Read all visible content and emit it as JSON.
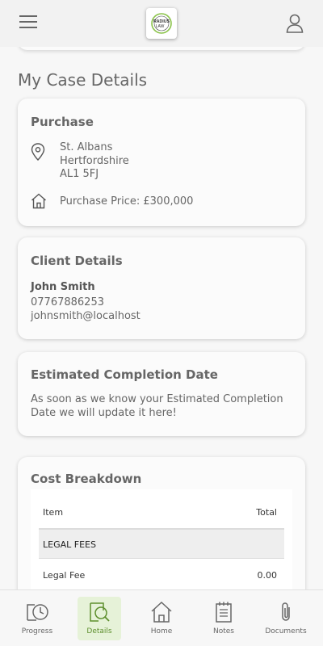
{
  "header": {
    "logo_text_line1": "RADIUS",
    "logo_text_line2": "LAW"
  },
  "page_title": "My Case Details",
  "purchase": {
    "title": "Purchase",
    "address_line1": "St. Albans",
    "address_line2": "Hertfordshire",
    "address_line3": "AL1 5FJ",
    "price_text": "Purchase Price: £300,000"
  },
  "client": {
    "title": "Client Details",
    "name": "John Smith",
    "phone": "07767886253",
    "email": "johnsmith@localhost"
  },
  "completion": {
    "title": "Estimated Completion Date",
    "message_line1": "As soon as we know your Estimated Completion",
    "message_line2": "Date we will update it here!"
  },
  "costs": {
    "title": "Cost Breakdown",
    "col_item": "Item",
    "col_total": "Total",
    "section": "LEGAL FEES",
    "rows": [
      {
        "item": "Legal Fee",
        "total": "0.00"
      }
    ]
  },
  "nav": [
    {
      "label": "Progress",
      "icon": "progress-clock-icon",
      "active": false
    },
    {
      "label": "Details",
      "icon": "details-search-icon",
      "active": true
    },
    {
      "label": "Home",
      "icon": "home-icon",
      "active": false
    },
    {
      "label": "Notes",
      "icon": "notes-icon",
      "active": false
    },
    {
      "label": "Documents",
      "icon": "paperclip-icon",
      "active": false
    }
  ],
  "colors": {
    "accent": "#8bc34a",
    "active_nav_bg": "#e6f2d8",
    "active_nav_text": "#5e8f2e"
  }
}
